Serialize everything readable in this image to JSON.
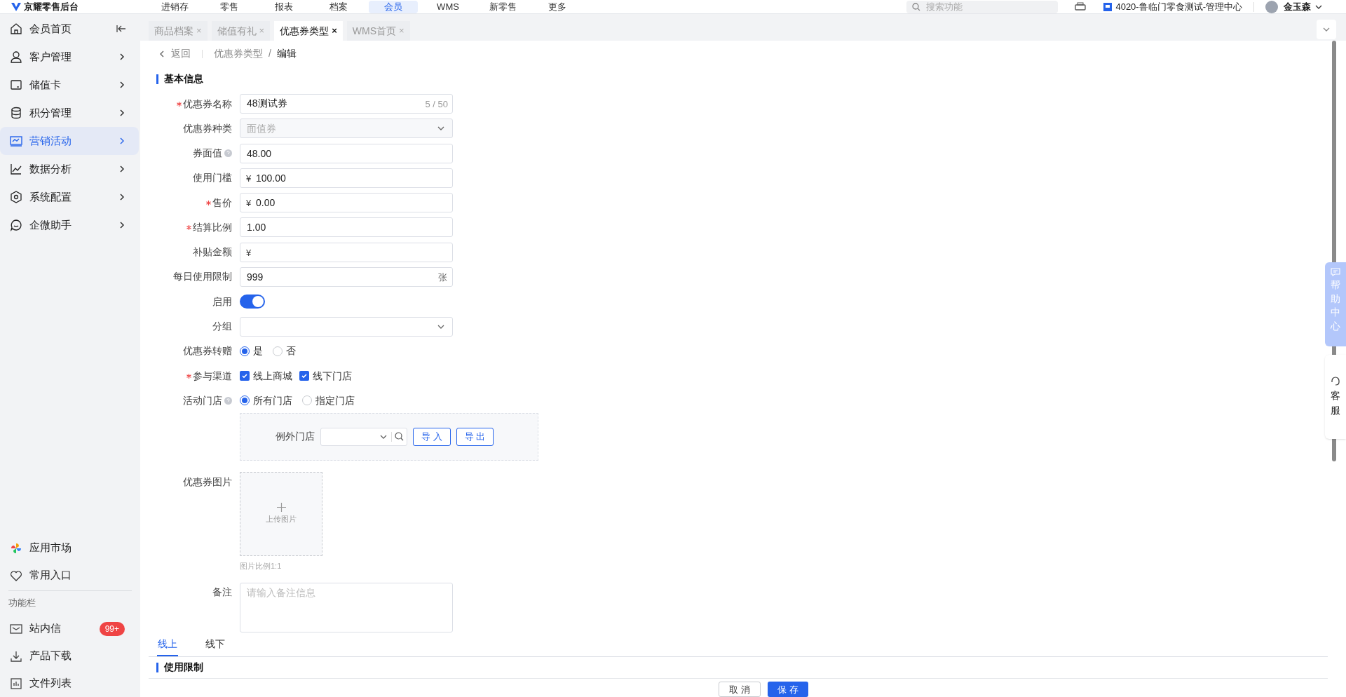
{
  "header": {
    "app_name": "京耀零售后台",
    "nav": [
      {
        "label": "进销存",
        "selected": false
      },
      {
        "label": "零售",
        "selected": false
      },
      {
        "label": "报表",
        "selected": false
      },
      {
        "label": "档案",
        "selected": false
      },
      {
        "label": "会员",
        "selected": true
      },
      {
        "label": "WMS",
        "selected": false
      },
      {
        "label": "新零售",
        "selected": false
      },
      {
        "label": "更多",
        "selected": false
      }
    ],
    "search": {
      "placeholder": "搜索功能"
    },
    "store": "4020-鲁临门零食测试-管理中心",
    "user": "金玉森"
  },
  "tabs": [
    {
      "label": "商品档案",
      "selected": false,
      "close": "×"
    },
    {
      "label": "储值有礼",
      "selected": false,
      "close": "×"
    },
    {
      "label": "优惠券类型",
      "selected": true,
      "close": "×"
    },
    {
      "label": "WMS首页",
      "selected": false,
      "close": "×"
    }
  ],
  "sidebar": {
    "items": [
      {
        "label": "会员首页",
        "selected": false
      },
      {
        "label": "客户管理",
        "selected": false
      },
      {
        "label": "储值卡",
        "selected": false
      },
      {
        "label": "积分管理",
        "selected": false
      },
      {
        "label": "营销活动",
        "selected": true
      },
      {
        "label": "数据分析",
        "selected": false
      },
      {
        "label": "系统配置",
        "selected": false
      },
      {
        "label": "企微助手",
        "selected": false
      }
    ],
    "bottom_items": [
      {
        "label": "应用市场"
      },
      {
        "label": "常用入口"
      }
    ],
    "section_label": "功能栏",
    "tools": [
      {
        "label": "站内信",
        "badge": "99+"
      },
      {
        "label": "产品下载"
      },
      {
        "label": "文件列表"
      }
    ]
  },
  "breadcrumb": {
    "back": "返回",
    "parent": "优惠券类型",
    "separator": "/",
    "current": "编辑"
  },
  "form": {
    "title": "基本信息",
    "fields": [
      {
        "kind": "input",
        "label": "优惠券名称",
        "required": true,
        "value": "48测试券",
        "counter": "5 / 50"
      },
      {
        "kind": "select",
        "label": "优惠券种类",
        "value": "面值券",
        "disabled": true
      },
      {
        "kind": "input",
        "label": "券面值",
        "help": true,
        "value": "48.00"
      },
      {
        "kind": "input",
        "label": "使用门槛",
        "prefix": "¥",
        "value": "100.00"
      },
      {
        "kind": "input",
        "label": "售价",
        "required": true,
        "prefix": "¥",
        "value": "0.00"
      },
      {
        "kind": "input",
        "label": "结算比例",
        "required": true,
        "value": "1.00"
      },
      {
        "kind": "input",
        "label": "补贴金额",
        "prefix": "¥"
      },
      {
        "kind": "input",
        "label": "每日使用限制",
        "value": "999",
        "suffix": "张"
      },
      {
        "kind": "switch",
        "label": "启用",
        "on": true
      },
      {
        "kind": "select",
        "label": "分组"
      },
      {
        "kind": "radio",
        "label": "优惠券转赠",
        "options": [
          {
            "label": "是",
            "selected": true
          },
          {
            "label": "否",
            "selected": false
          }
        ]
      },
      {
        "kind": "checkbox",
        "label": "参与渠道",
        "required": true,
        "options": [
          {
            "label": "线上商城",
            "checked": true
          },
          {
            "label": "线下门店",
            "checked": true
          }
        ]
      },
      {
        "kind": "radio",
        "label": "活动门店",
        "help": true,
        "options": [
          {
            "label": "所有门店",
            "selected": true
          },
          {
            "label": "指定门店",
            "selected": false
          }
        ]
      },
      {
        "kind": "store_panel",
        "label": "例外门店",
        "buttons": [
          "导 入",
          "导 出"
        ]
      },
      {
        "kind": "upload",
        "label": "优惠券图片",
        "text": "上传图片",
        "hint": "图片比例1:1"
      },
      {
        "kind": "textarea",
        "label": "备注",
        "placeholder": "请输入备注信息"
      }
    ]
  },
  "subtabs": [
    {
      "label": "线上",
      "selected": true
    },
    {
      "label": "线下",
      "selected": false
    }
  ],
  "section2_title": "使用限制",
  "footer_buttons": [
    {
      "label": "取 消",
      "primary": false
    },
    {
      "label": "保 存",
      "primary": true
    }
  ],
  "float": {
    "help": "帮助中心",
    "service": "客服"
  }
}
